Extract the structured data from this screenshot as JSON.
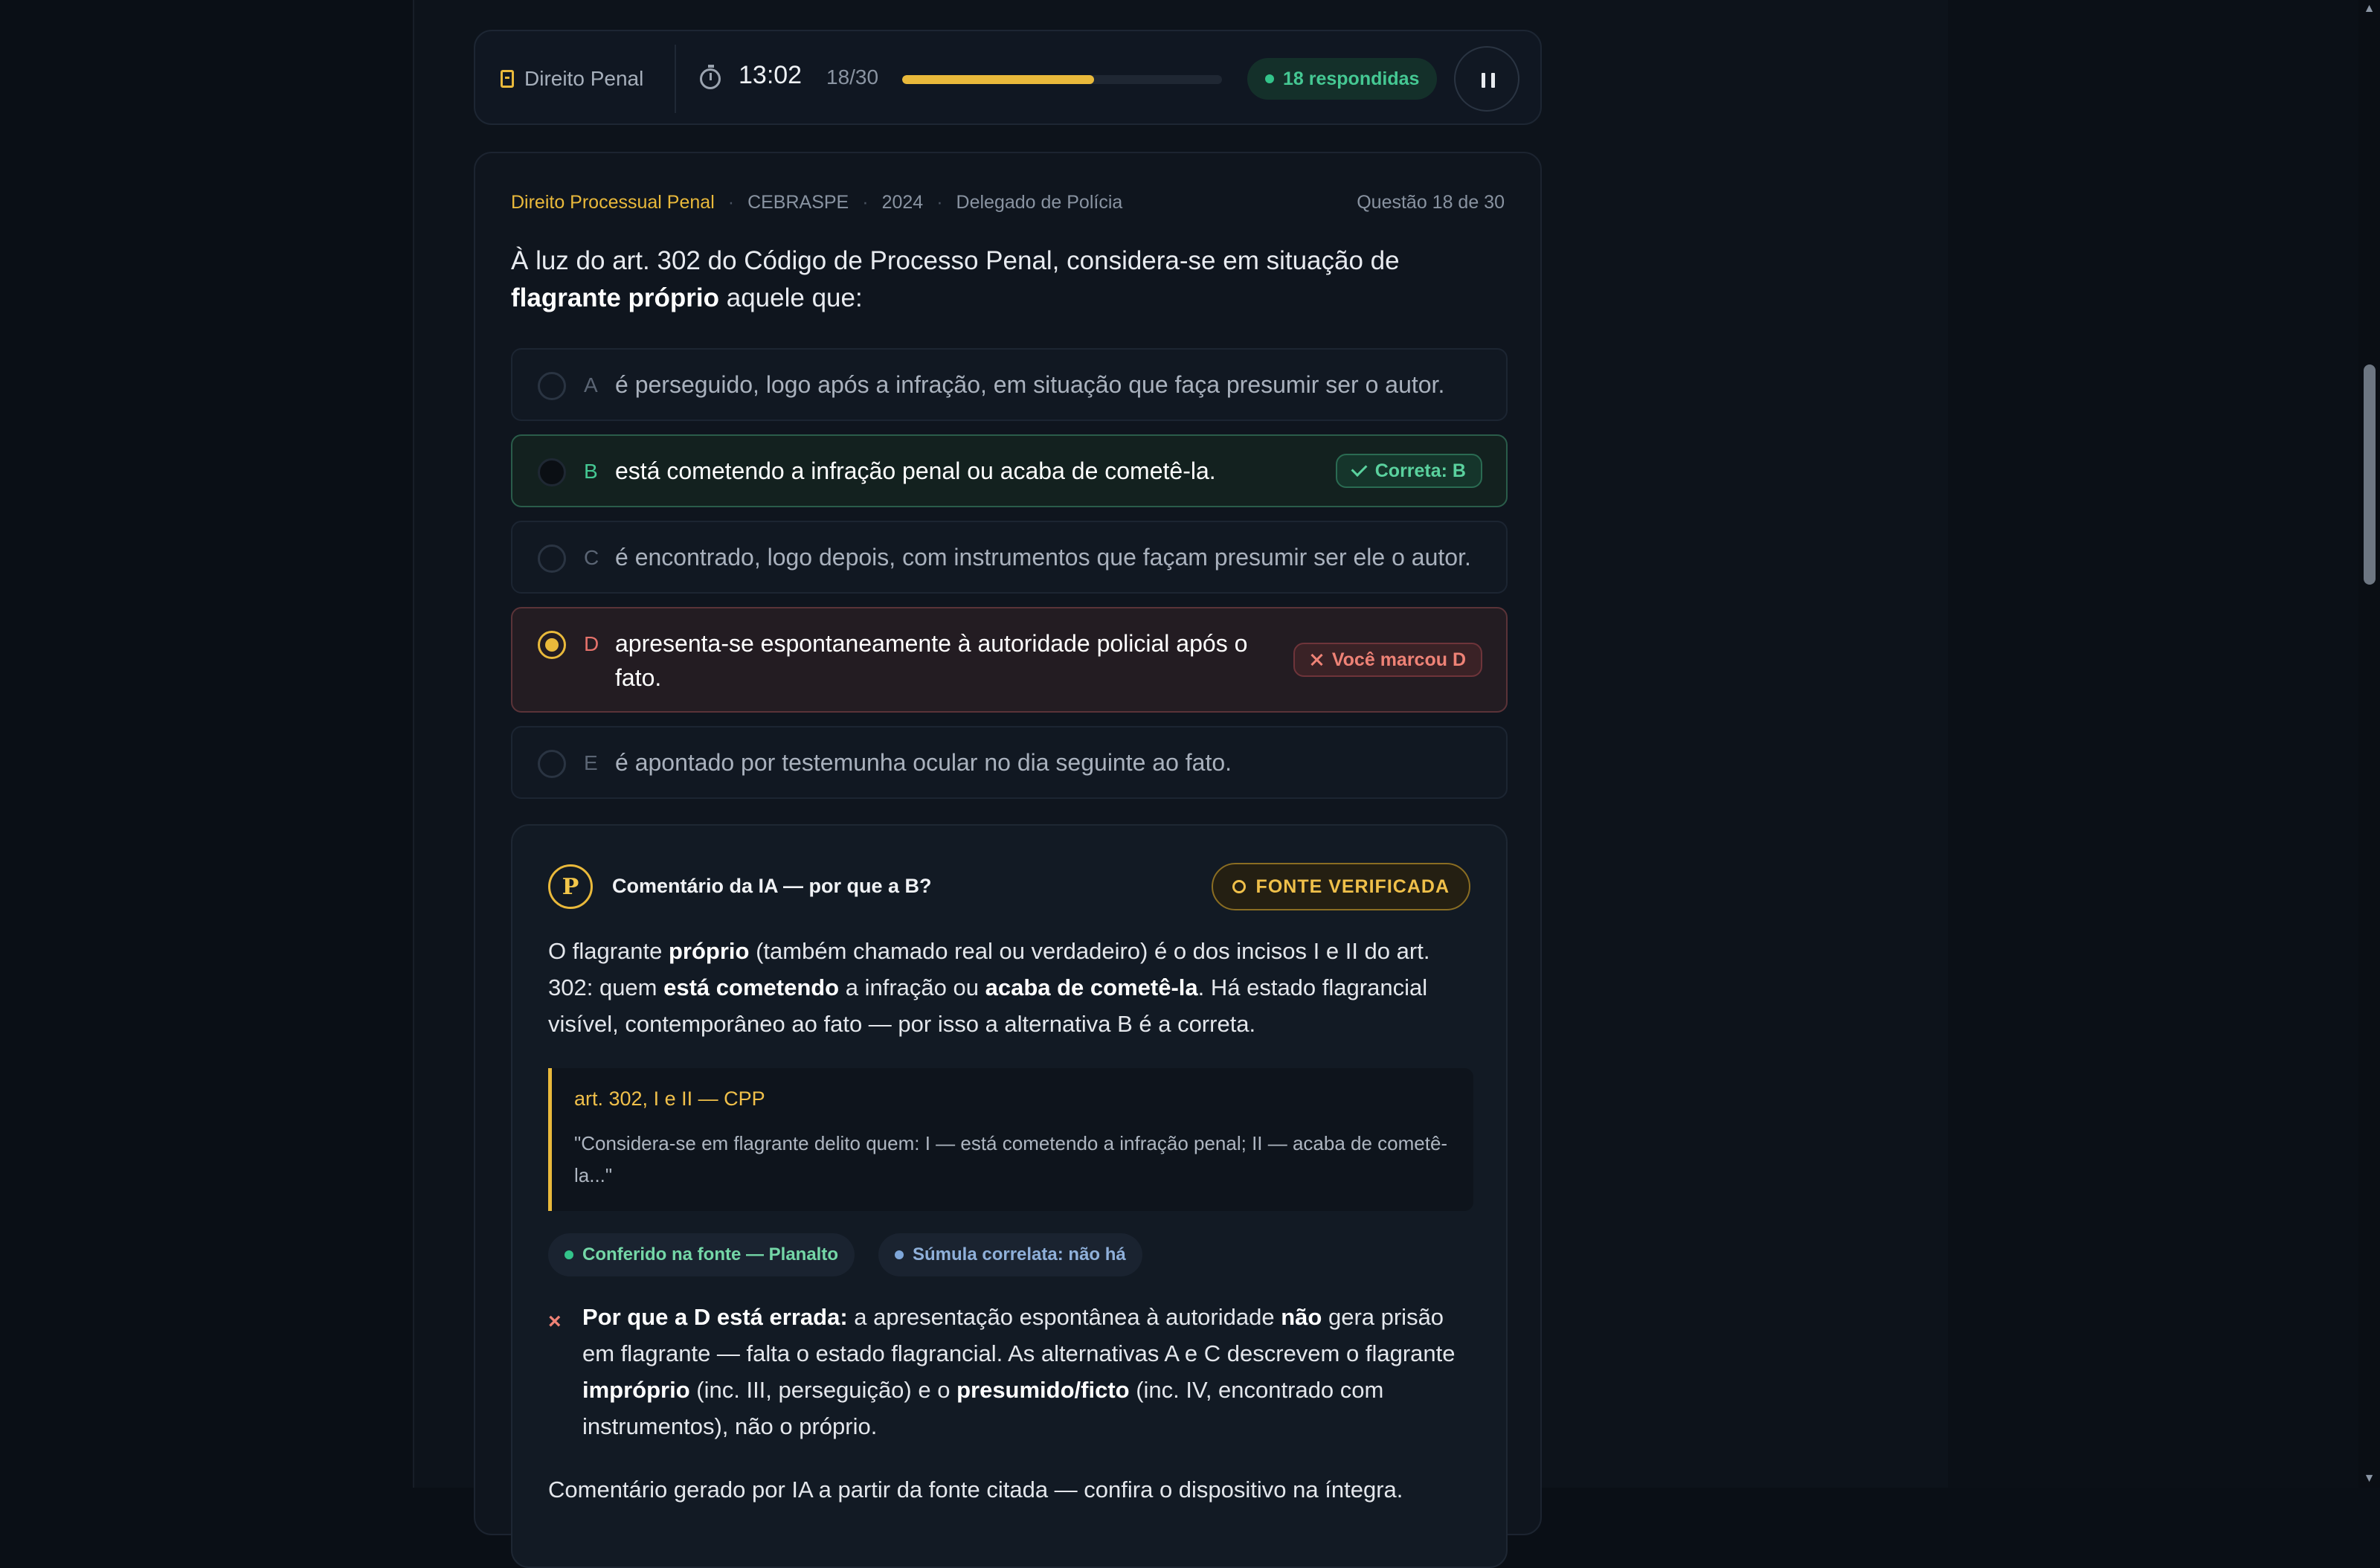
{
  "topbar": {
    "subject": "Direito Penal",
    "timer": "13:02",
    "count": "18/30",
    "progress": 0.6,
    "answered": "18 respondidas"
  },
  "question": {
    "discipline": "Direito Processual Penal",
    "board": "CEBRASPE",
    "year": "2024",
    "position": "Delegado de Polícia",
    "number": "Questão 18 de 30",
    "stem_part1": "À luz do art. 302 do Código de Processo Penal, considera-se em situação de ",
    "stem_bold": "flagrante próprio",
    "stem_part2": " aquele que:",
    "options": [
      {
        "letter": "A",
        "text": "é perseguido, logo após a infração, em situação que faça presumir ser o autor."
      },
      {
        "letter": "B",
        "text": "está cometendo a infração penal ou acaba de cometê-la.",
        "tag": "Correta: B"
      },
      {
        "letter": "C",
        "text": "é encontrado, logo depois, com instrumentos que façam presumir ser ele o autor."
      },
      {
        "letter": "D",
        "text": "apresenta-se espontaneamente à autoridade policial após o fato.",
        "tag": "Você marcou D"
      },
      {
        "letter": "E",
        "text": "é apontado por testemunha ocular no dia seguinte ao fato."
      }
    ]
  },
  "comment": {
    "avatar": "P",
    "title": "Comentário da IA — por que a B?",
    "badge": "FONTE VERIFICADA",
    "p1_a": "O flagrante ",
    "p1_b": "próprio",
    "p1_c": " (também chamado real ou verdadeiro) é o dos incisos I e II do art. 302: quem ",
    "p1_d": "está cometendo",
    "p1_e": " a infração ou ",
    "p1_f": "acaba de cometê-la",
    "p1_g": ". Há estado flagrancial visível, contemporâneo ao fato — por isso a alternativa B é a correta.",
    "quote_ref": "art. 302, I e II — CPP",
    "quote_text": "\"Considera-se em flagrante delito quem: I — está cometendo a infração penal; II — acaba de cometê-la...\"",
    "chip_source": "Conferido na fonte — Planalto",
    "chip_sumula": "Súmula correlata: não há",
    "why_icon": "×",
    "why_a": "Por que a D está errada:",
    "why_b": " a apresentação espontânea à autoridade ",
    "why_c": "não",
    "why_d": " gera prisão em flagrante — falta o estado flagrancial. As alternativas A e C descrevem o flagrante ",
    "why_e": "impróprio",
    "why_f": " (inc. III, perseguição) e o ",
    "why_g": "presumido/ficto",
    "why_h": " (inc. IV, encontrado com instrumentos), não o próprio.",
    "footnote": "Comentário gerado por IA a partir da fonte citada — confira o dispositivo na íntegra."
  },
  "colors": {
    "accent": "#e9b93b",
    "correct": "#45c893",
    "wrong": "#ee8276"
  }
}
